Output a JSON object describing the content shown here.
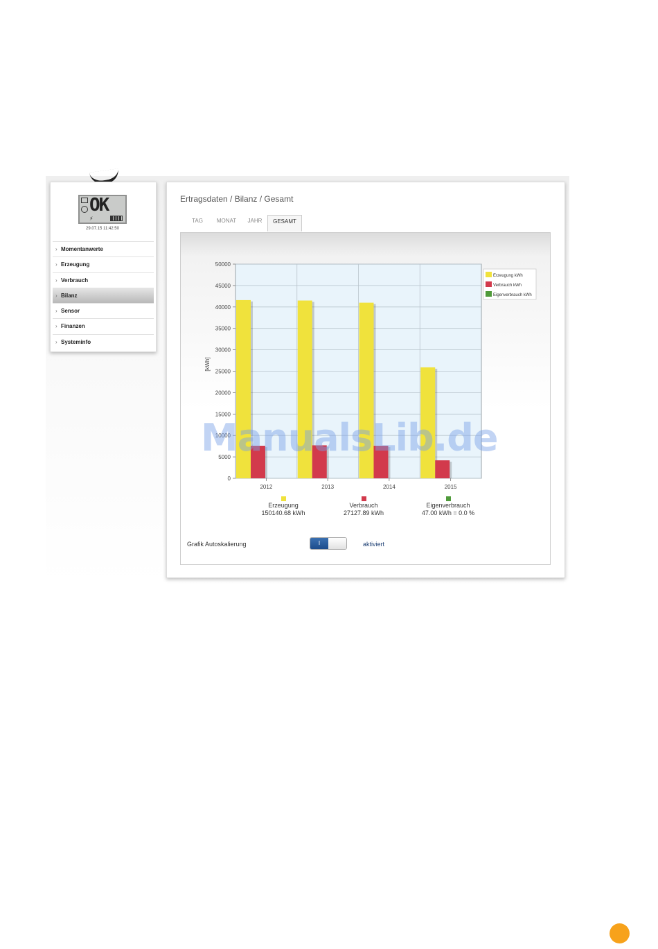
{
  "lcd": {
    "status_text": "OK",
    "timestamp": "29.07.15 11:42:50"
  },
  "sidebar": {
    "items": [
      {
        "label": "Momentanwerte",
        "active": false
      },
      {
        "label": "Erzeugung",
        "active": false
      },
      {
        "label": "Verbrauch",
        "active": false
      },
      {
        "label": "Bilanz",
        "active": true
      },
      {
        "label": "Sensor",
        "active": false
      },
      {
        "label": "Finanzen",
        "active": false
      },
      {
        "label": "Systeminfo",
        "active": false
      }
    ]
  },
  "main": {
    "breadcrumb": "Ertragsdaten / Bilanz / Gesamt",
    "tabs": [
      {
        "label": "TAG",
        "active": false
      },
      {
        "label": "MONAT",
        "active": false
      },
      {
        "label": "JAHR",
        "active": false
      },
      {
        "label": "GESAMT",
        "active": true
      }
    ]
  },
  "chart_data": {
    "type": "bar",
    "categories": [
      "2012",
      "2013",
      "2014",
      "2015"
    ],
    "series": [
      {
        "name": "Erzeugung kWh",
        "color": "#f0e23c",
        "values": [
          41600,
          41500,
          41000,
          25900
        ]
      },
      {
        "name": "Verbrauch kWh",
        "color": "#d23a4c",
        "values": [
          7600,
          7700,
          7600,
          4200
        ]
      },
      {
        "name": "Eigenverbrauch kWh",
        "color": "#4f9a3a",
        "values": [
          0,
          0,
          0,
          0
        ]
      }
    ],
    "ylabel": "[kWh]",
    "ylim": [
      0,
      50000
    ],
    "yticks": [
      0,
      5000,
      10000,
      15000,
      20000,
      25000,
      30000,
      35000,
      40000,
      45000,
      50000
    ],
    "grid": true,
    "legend_placement": "top-right",
    "summary": [
      {
        "label": "Erzeugung",
        "value": "150140.68 kWh",
        "color": "#f0e23c"
      },
      {
        "label": "Verbrauch",
        "value": "27127.89 kWh",
        "color": "#d23a4c"
      },
      {
        "label": "Eigenverbrauch",
        "value": "47.00 kWh = 0.0 %",
        "color": "#4f9a3a"
      }
    ]
  },
  "settings": {
    "autoscale_label": "Grafik Autoskalierung",
    "toggle_on_text": "I",
    "toggle_status": "aktiviert"
  },
  "watermark": "ManualsLib.de"
}
